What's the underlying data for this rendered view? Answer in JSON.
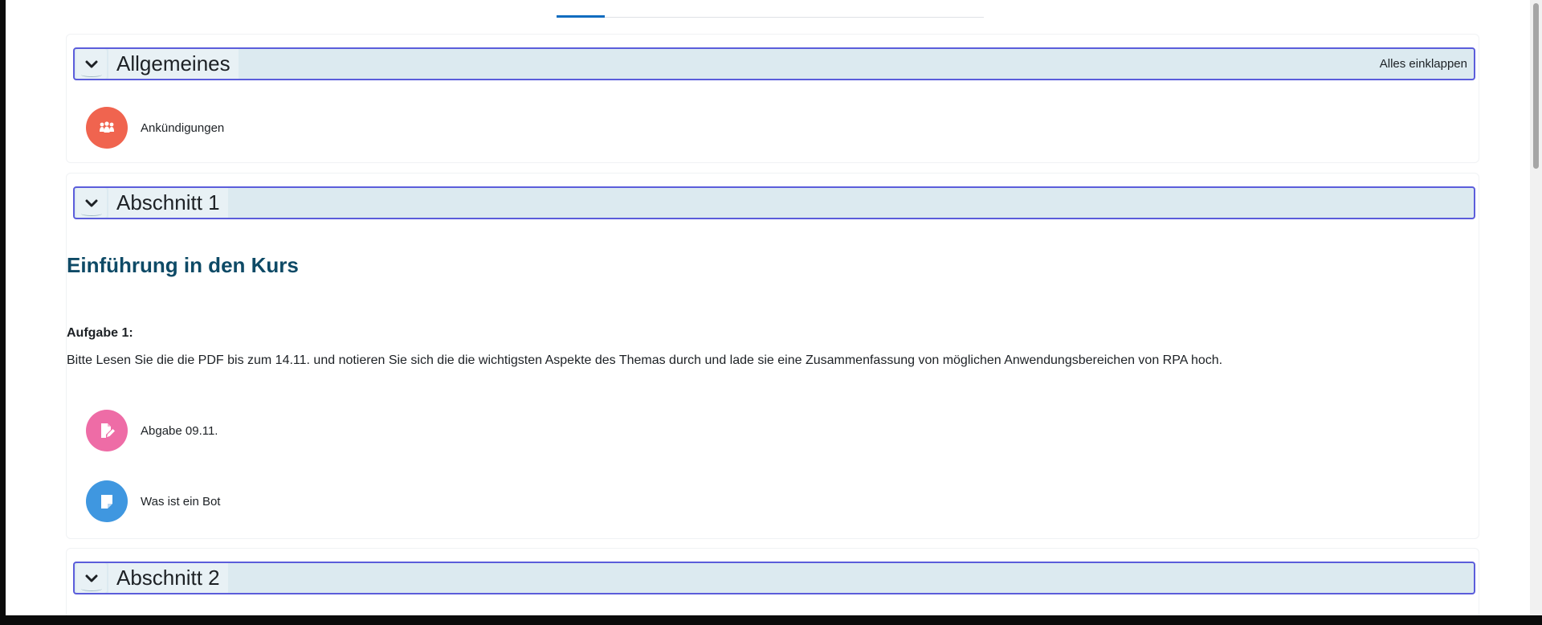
{
  "sections": [
    {
      "title": "Allgemeines",
      "collapse_all_label": "Alles einklappen",
      "activities": [
        {
          "label": "Ankündigungen",
          "icon": "forum-icon",
          "color": "#f0644f"
        }
      ]
    },
    {
      "title": "Abschnitt 1",
      "heading": "Einführung in den Kurs",
      "task_label": "Aufgabe 1:",
      "task_text": "Bitte Lesen Sie die die PDF bis zum 14.11. und notieren Sie sich die die wichtigsten Aspekte des Themas durch und lade sie eine Zusammenfassung von möglichen Anwendungsbereichen von RPA hoch.",
      "activities": [
        {
          "label": "Abgabe 09.11.",
          "icon": "assignment-icon",
          "color": "#ee6ca6"
        },
        {
          "label": "Was ist ein Bot",
          "icon": "page-icon",
          "color": "#3f97e0"
        }
      ]
    },
    {
      "title": "Abschnitt 2"
    }
  ],
  "colors": {
    "header_border": "#5b5ddb",
    "header_bg": "#dceaf0",
    "heading_text": "#0e4a66",
    "tab_active": "#0f6cbf"
  }
}
